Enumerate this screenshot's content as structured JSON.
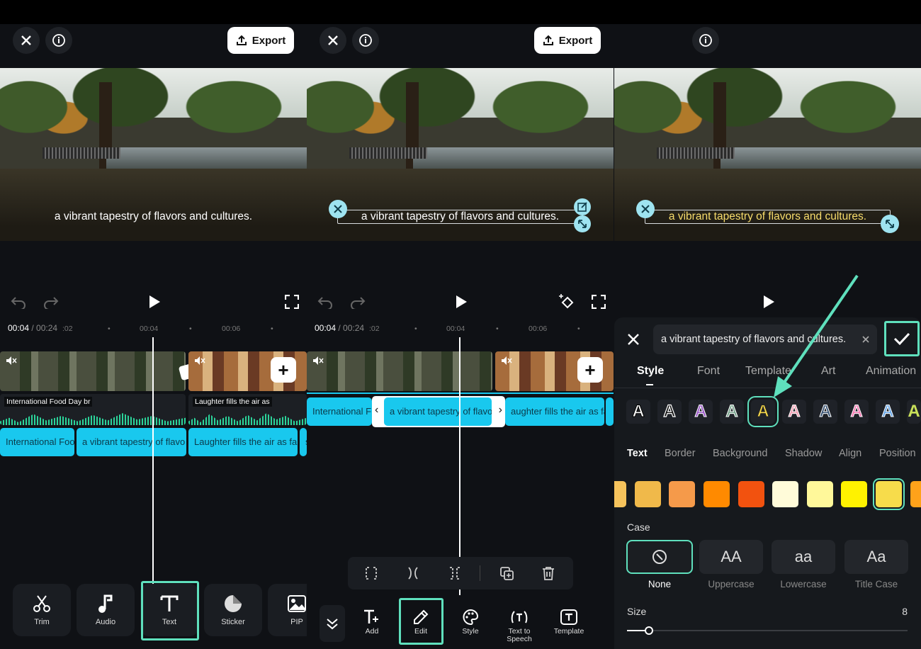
{
  "export_label": "Export",
  "caption_text": "a vibrant tapestry of flavors and cultures.",
  "timeline": {
    "current": "00:04",
    "total": "/ 00:24",
    "ticks": [
      ":02",
      "00:04",
      "00:06"
    ]
  },
  "panel1": {
    "audio_labels": [
      "International Food Day br",
      "Laughter fills the air as"
    ],
    "text_clips": [
      "International Food",
      "a vibrant tapestry of flavo",
      "Laughter fills the air as fa",
      "s"
    ],
    "tools": [
      {
        "label": "Trim",
        "icon": "scissors-icon"
      },
      {
        "label": "Audio",
        "icon": "music-note-icon"
      },
      {
        "label": "Text",
        "icon": "text-icon"
      },
      {
        "label": "Sticker",
        "icon": "sticker-icon"
      },
      {
        "label": "PIP",
        "icon": "pip-icon"
      }
    ]
  },
  "panel2": {
    "text_clips": [
      "International F",
      "a vibrant tapestry of flavo",
      "aughter fills the air as fa"
    ],
    "tools": [
      {
        "label": "Add",
        "icon": "text-add-icon"
      },
      {
        "label": "Edit",
        "icon": "pencil-icon"
      },
      {
        "label": "Style",
        "icon": "palette-icon"
      },
      {
        "label": "Text to Speech",
        "icon": "text-to-speech-icon"
      },
      {
        "label": "Template",
        "icon": "template-icon"
      }
    ]
  },
  "panel3": {
    "input_value": "a vibrant tapestry of flavors and cultures.",
    "tabs": [
      "Style",
      "Font",
      "Template",
      "Art",
      "Animation"
    ],
    "subtabs": [
      "Text",
      "Border",
      "Background",
      "Shadow",
      "Align",
      "Position"
    ],
    "style_glyph": "A",
    "case_title": "Case",
    "cases": [
      {
        "label": "None",
        "glyph": ""
      },
      {
        "label": "Uppercase",
        "glyph": "AA"
      },
      {
        "label": "Lowercase",
        "glyph": "aa"
      },
      {
        "label": "Title Case",
        "glyph": "Aa"
      }
    ],
    "size_label": "Size",
    "size_value": "8",
    "swatches": [
      "#f6c35c",
      "#f0b94a",
      "#f59a4a",
      "#ff8a00",
      "#f2520f",
      "#fffbd9",
      "#fff89a",
      "#fff200",
      "#f7dc4b",
      "#ffa21a"
    ]
  },
  "colors": {
    "accent": "#5fe0bd",
    "clip": "#19c8ee"
  }
}
